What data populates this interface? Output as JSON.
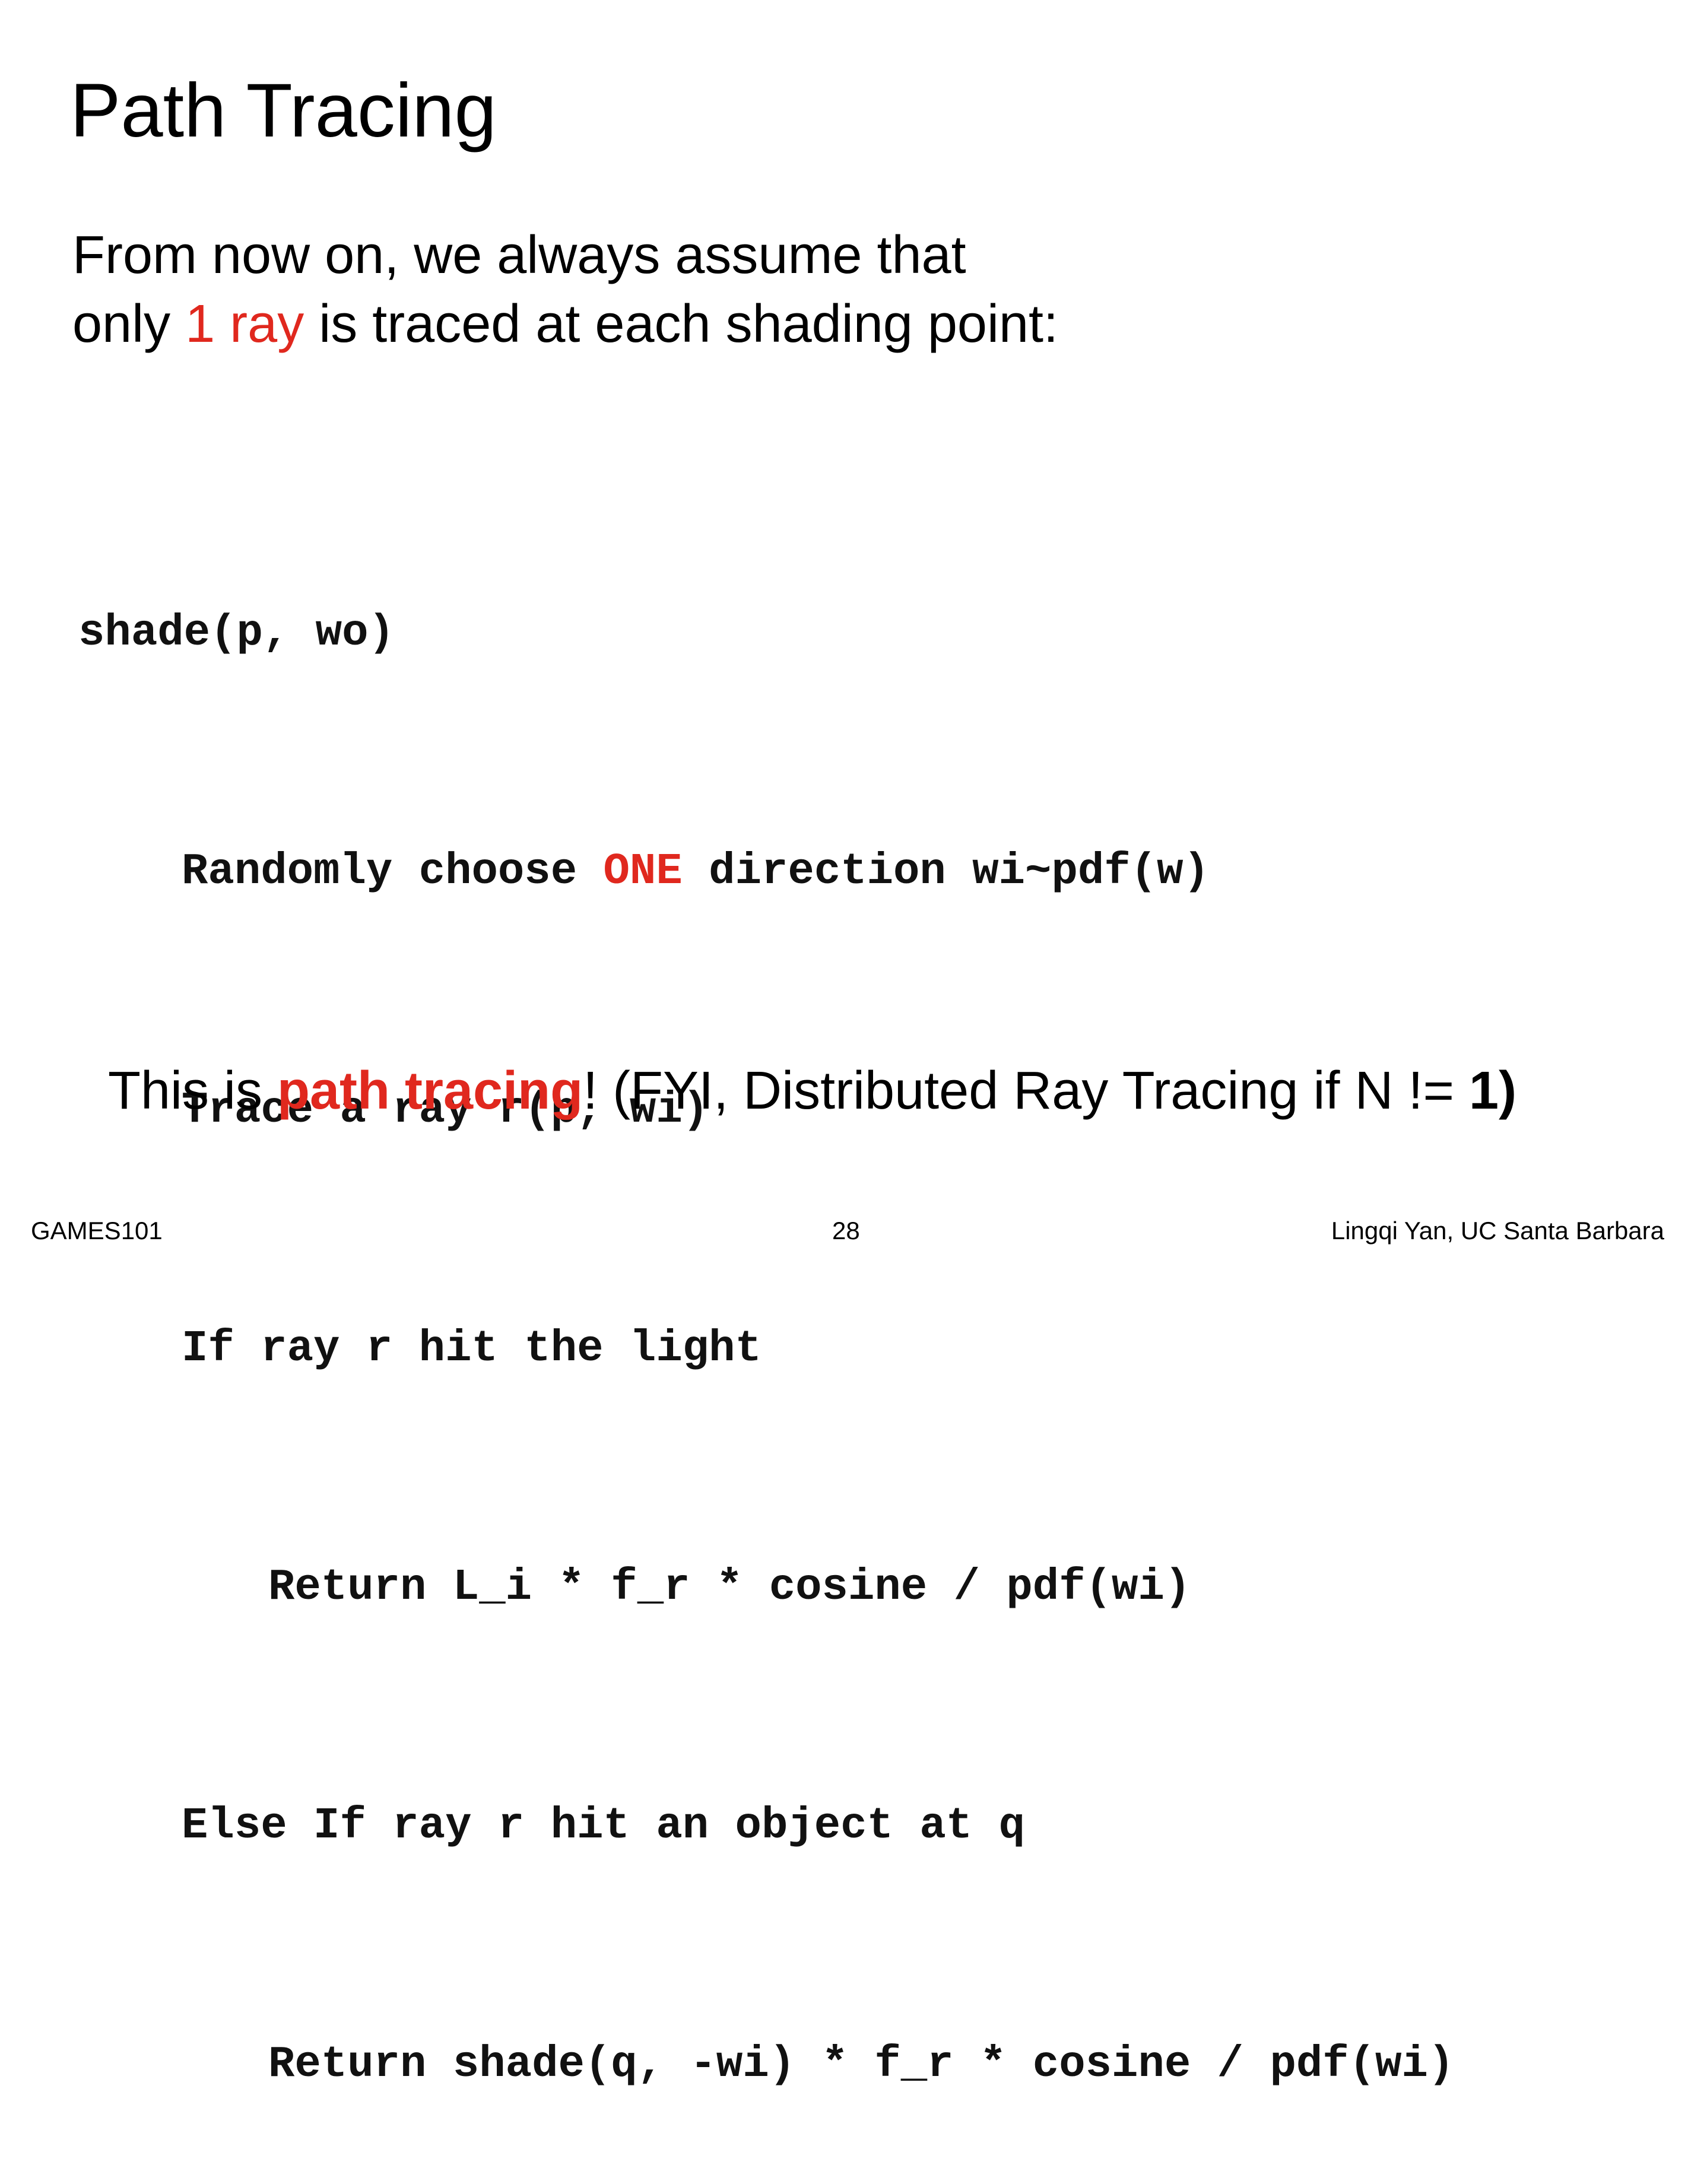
{
  "title": "Path Tracing",
  "intro": {
    "line1": "From now on, we always assume that",
    "line2_pre": "only ",
    "line2_highlight": "1 ray",
    "line2_post": " is traced at each shading point:"
  },
  "code": {
    "l1": "shade(p, wo)",
    "l2_pre": "Randomly choose ",
    "l2_highlight": "ONE",
    "l2_post": " direction wi~pdf(w)",
    "l3": "Trace a ray r(p, wi)",
    "l4": "If ray r hit the light",
    "l5": "Return L_i * f_r * cosine / pdf(wi)",
    "l6": "Else If ray r hit an object at q",
    "l7": "Return shade(q, -wi) * f_r * cosine / pdf(wi)"
  },
  "summary": {
    "pre": "This is ",
    "highlight": "path tracing",
    "mid": "! (FYI, Distributed Ray Tracing if N != ",
    "bold": "1)"
  },
  "footer": {
    "left": "GAMES101",
    "page_number": "28",
    "right": "Lingqi Yan, UC Santa Barbara"
  },
  "colors": {
    "accent": "#e0281e",
    "text": "#000000",
    "background": "#ffffff"
  }
}
